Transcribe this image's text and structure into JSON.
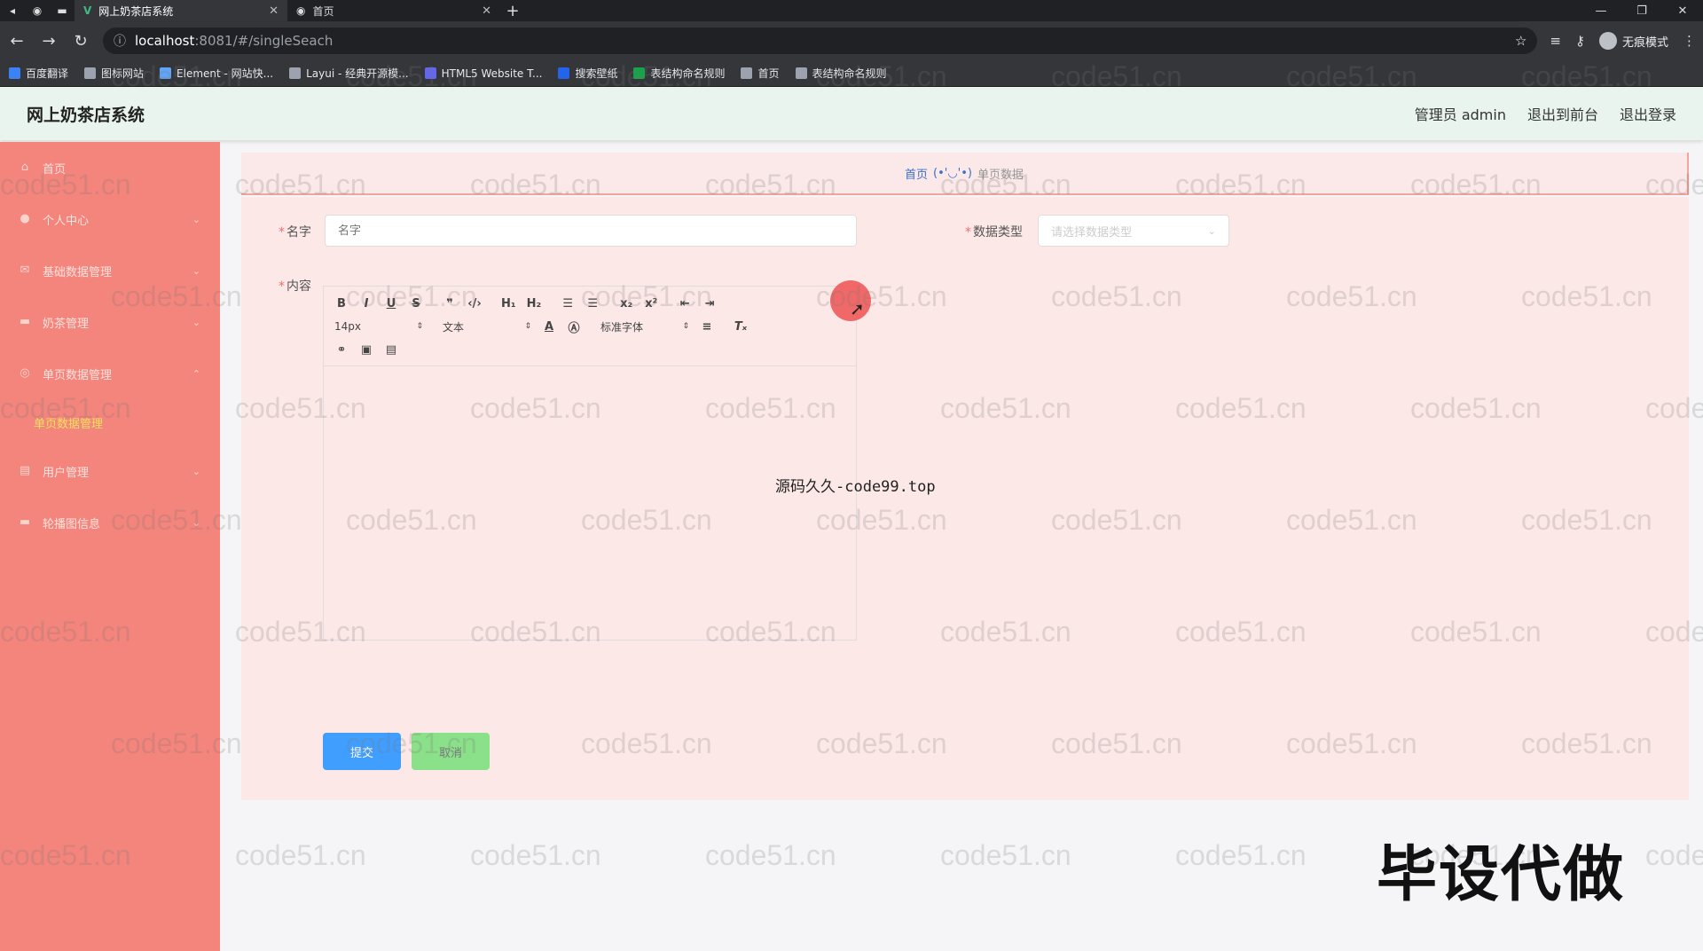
{
  "browser": {
    "tabs": [
      {
        "title": "网上奶茶店系统",
        "active": true
      },
      {
        "title": "首页",
        "active": false
      }
    ],
    "url_host": "localhost",
    "url_path": ":8081/#/singleSeach",
    "incognito_label": "无痕模式",
    "bookmarks": [
      {
        "label": "百度翻译",
        "color": "#3b82f6"
      },
      {
        "label": "图标网站",
        "color": "#9ca3af"
      },
      {
        "label": "Element - 网站快...",
        "color": "#60a5fa"
      },
      {
        "label": "Layui - 经典开源模...",
        "color": "#9ca3af"
      },
      {
        "label": "HTML5 Website T...",
        "color": "#6366f1"
      },
      {
        "label": "搜索壁纸",
        "color": "#2563eb"
      },
      {
        "label": "表结构命名规则",
        "color": "#16a34a"
      },
      {
        "label": "首页",
        "color": "#9ca3af"
      },
      {
        "label": "表结构命名规则",
        "color": "#9ca3af"
      }
    ]
  },
  "header": {
    "title": "网上奶茶店系统",
    "admin_label": "管理员 admin",
    "to_front_label": "退出到前台",
    "logout_label": "退出登录"
  },
  "sidebar": {
    "items": [
      {
        "label": "首页",
        "icon": "home-icon",
        "has_arrow": false
      },
      {
        "label": "个人中心",
        "icon": "user-icon",
        "has_arrow": true
      },
      {
        "label": "基础数据管理",
        "icon": "mail-icon",
        "has_arrow": true
      },
      {
        "label": "奶茶管理",
        "icon": "monitor-icon",
        "has_arrow": true
      },
      {
        "label": "单页数据管理",
        "icon": "circle-icon",
        "has_arrow": true,
        "expanded": true
      },
      {
        "label": "单页数据管理",
        "sub": true
      },
      {
        "label": "用户管理",
        "icon": "doc-icon",
        "has_arrow": true
      },
      {
        "label": "轮播图信息",
        "icon": "monitor-icon",
        "has_arrow": true
      }
    ]
  },
  "breadcrumb": {
    "home": "首页",
    "face": "(•'◡'•)",
    "current": "单页数据"
  },
  "form": {
    "name_label": "名字",
    "name_placeholder": "名字",
    "type_label": "数据类型",
    "type_placeholder": "请选择数据类型",
    "content_label": "内容",
    "submit_label": "提交",
    "cancel_label": "取消"
  },
  "editor": {
    "font_size": "14px",
    "block_type": "文本",
    "font_family": "标准字体"
  },
  "overlays": {
    "center_text": "源码久久-code99.top",
    "corner_text": "毕设代做",
    "watermark": "code51.cn"
  }
}
